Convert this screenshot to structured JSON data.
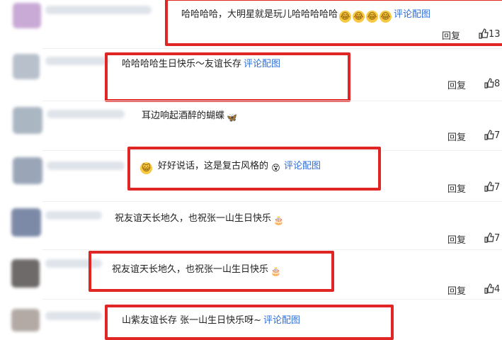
{
  "comments": [
    {
      "text": "哈哈哈哈，大明星就是玩儿哈哈哈哈哈",
      "emojis": [
        "laugh-emoji",
        "laugh-emoji",
        "laugh-emoji",
        "laugh-emoji"
      ],
      "link": "评论配图",
      "reply": "回复",
      "likes": "13"
    },
    {
      "text": "哈哈哈哈生日快乐～友谊长存",
      "link": "评论配图",
      "reply": "回复",
      "likes": "8"
    },
    {
      "text": "耳边响起酒醉的蝴蝶",
      "emoji": "🦋",
      "reply": "回复",
      "likes": "7"
    },
    {
      "text": "好好说话，这是复古风格的",
      "emoji": "😵",
      "link": "评论配图",
      "reply": "回复",
      "likes": "7"
    },
    {
      "text": "祝友谊天长地久，也祝张一山生日快乐",
      "emoji": "🎂",
      "reply": "回复",
      "likes": "7"
    },
    {
      "text": "祝友谊天长地久，也祝张一山生日快乐",
      "emoji": "🎂",
      "reply": "回复",
      "likes": "4"
    },
    {
      "text": "山紫友谊长存 张一山生日快乐呀~",
      "link": "评论配图"
    }
  ],
  "colors": {
    "highlight_box": "#e02525",
    "link": "#2e6fd8"
  }
}
